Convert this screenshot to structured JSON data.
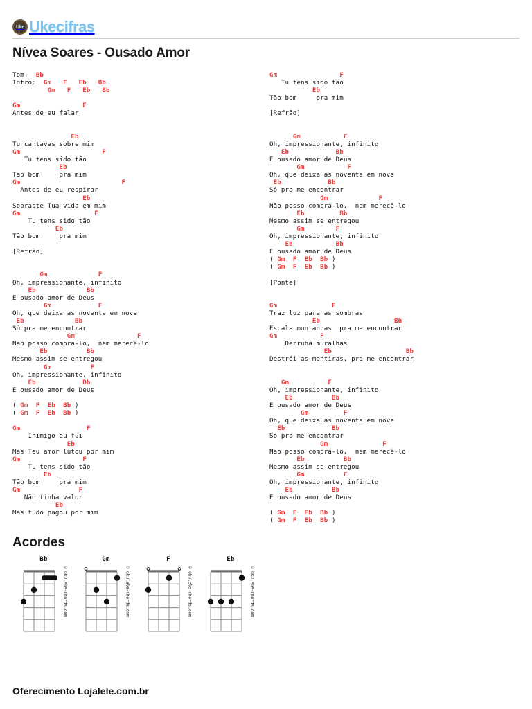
{
  "site": {
    "logo_badge_text": "Uke",
    "logo_word": "Ukecifras",
    "logo_color": "#7ec2ee"
  },
  "header": {
    "title": "Nívea Soares - Ousado Amor"
  },
  "colors": {
    "chord": "#ef3b3b",
    "text": "#111111",
    "rule": "#cfcfcf"
  },
  "meta": {
    "tom_label": "Tom:",
    "tom_value": "Bb",
    "intro_label": "Intro:",
    "intro_chords_line1": "Gm   F   Eb   Bb",
    "intro_chords_line2": "Gm   F   Eb   Bb"
  },
  "sections": {
    "refrao_marker": "[Refrão]",
    "ponte_marker": "[Ponte]"
  },
  "columns": {
    "left": "Tom:  <b>Bb</b>\nIntro:  <b>Gm</b>   <b>F</b>   <b>Eb</b>   <b>Bb</b>\n         <b>Gm</b>   <b>F</b>   <b>Eb</b>   <b>Bb</b>\n\n<b>Gm</b>                <b>F</b>\nAntes de eu falar\n\n\n               <b>Eb</b>\nTu cantavas sobre mim\n<b>Gm</b>                     <b>F</b>\n   Tu tens sido tão\n            <b>Eb</b>\nTão bom     pra mim\n<b>Gm</b>                          <b>F</b>\n  Antes de eu respirar\n                  <b>Eb</b>\nSopraste Tua vida em mim\n<b>Gm</b>                   <b>F</b>\n    Tu tens sido tão\n           <b>Eb</b>\nTão bom     pra mim\n\n[Refrão]\n\n\n       <b>Gm</b>             <b>F</b>\nOh, impressionante, infinito\n    <b>Eb</b>             <b>Bb</b>\nE ousado amor de Deus\n        <b>Gm</b>            <b>F</b>\nOh, que deixa as noventa em nove\n <b>Eb</b>             <b>Bb</b>\nSó pra me encontrar\n              <b>Gm</b>                <b>F</b>\nNão posso comprá-lo,  nem merecê-lo\n       <b>Eb</b>          <b>Bb</b>\nMesmo assim se entregou\n        <b>Gm</b>          <b>F</b>\nOh, impressionante, infinito\n    <b>Eb</b>            <b>Bb</b>\nE ousado amor de Deus\n\n( <b>Gm</b>  <b>F</b>  <b>Eb</b>  <b>Bb</b> )\n( <b>Gm</b>  <b>F</b>  <b>Eb</b>  <b>Bb</b> )\n\n<b>Gm</b>                 <b>F</b>\n    Inimigo eu fui\n              <b>Eb</b>\nMas Teu amor lutou por mim\n<b>Gm</b>                <b>F</b>\n    Tu tens sido tão\n        <b>Eb</b>\nTão bom     pra mim\n<b>Gm</b>               <b>F</b>\n   Não tinha valor\n           <b>Eb</b>\nMas tudo pagou por mim",
    "right": "<b>Gm</b>                <b>F</b>\n   Tu tens sido tão\n           <b>Eb</b>\nTão bom     pra mim\n\n[Refrão]\n\n\n      <b>Gm</b>           <b>F</b>\nOh, impressionante, infinito\n   <b>Eb</b>            <b>Bb</b>\nE ousado amor de Deus\n       <b>Gm</b>           <b>F</b>\nOh, que deixa as noventa em nove\n <b>Eb</b>            <b>Bb</b>\nSó pra me encontrar\n             <b>Gm</b>             <b>F</b>\nNão posso comprá-lo,  nem merecê-lo\n       <b>Eb</b>         <b>Bb</b>\nMesmo assim se entregou\n       <b>Gm</b>        <b>F</b>\nOh, impressionante, infinito\n    <b>Eb</b>           <b>Bb</b>\nE ousado amor de Deus\n( <b>Gm</b>  <b>F</b>  <b>Eb</b>  <b>Bb</b> )\n( <b>Gm</b>  <b>F</b>  <b>Eb</b>  <b>Bb</b> )\n\n[Ponte]\n\n\n<b>Gm</b>              <b>F</b>\nTraz luz para as sombras\n           <b>Eb</b>                   <b>Bb</b>\nEscala montanhas  pra me encontrar\n<b>Gm</b>           <b>F</b>\n    Derruba muralhas\n              <b>Eb</b>                   <b>Bb</b>\nDestrói as mentiras, pra me encontrar\n\n\n   <b>Gm</b>          <b>F</b>\nOh, impressionante, infinito\n    <b>Eb</b>          <b>Bb</b>\nE ousado amor de Deus\n        <b>Gm</b>         <b>F</b>\nOh, que deixa as noventa em nove\n  <b>Eb</b>            <b>Bb</b>\nSó pra me encontrar\n             <b>Gm</b>              <b>F</b>\nNão posso comprá-lo,  nem merecê-lo\n       <b>Eb</b>          <b>Bb</b>\nMesmo assim se entregou\n       <b>Gm</b>          <b>F</b>\nOh, impressionante, infinito\n    <b>Eb</b>          <b>Bb</b>\nE ousado amor de Deus\n\n( <b>Gm</b>  <b>F</b>  <b>Eb</b>  <b>Bb</b> )\n( <b>Gm</b>  <b>F</b>  <b>Eb</b>  <b>Bb</b> )"
  },
  "acordes": {
    "heading": "Acordes",
    "credit": "ukulele-chords.com",
    "credit_mark": "©",
    "chords": [
      {
        "name": "Bb",
        "open_strings": [],
        "dots": [
          {
            "string": 1,
            "fret": 3
          },
          {
            "string": 2,
            "fret": 2
          }
        ],
        "barres": [
          {
            "fret": 1,
            "from_string": 3,
            "to_string": 4
          }
        ]
      },
      {
        "name": "Gm",
        "open_strings": [
          1
        ],
        "dots": [
          {
            "string": 4,
            "fret": 1
          },
          {
            "string": 2,
            "fret": 2
          },
          {
            "string": 3,
            "fret": 3
          }
        ],
        "barres": []
      },
      {
        "name": "F",
        "open_strings": [
          1,
          4
        ],
        "dots": [
          {
            "string": 3,
            "fret": 1
          },
          {
            "string": 1,
            "fret": 2
          }
        ],
        "barres": []
      },
      {
        "name": "Eb",
        "open_strings": [],
        "dots": [
          {
            "string": 4,
            "fret": 1
          },
          {
            "string": 1,
            "fret": 3
          },
          {
            "string": 2,
            "fret": 3
          },
          {
            "string": 3,
            "fret": 3
          }
        ],
        "barres": []
      }
    ]
  },
  "footer": {
    "text": "Oferecimento Lojalele.com.br"
  }
}
